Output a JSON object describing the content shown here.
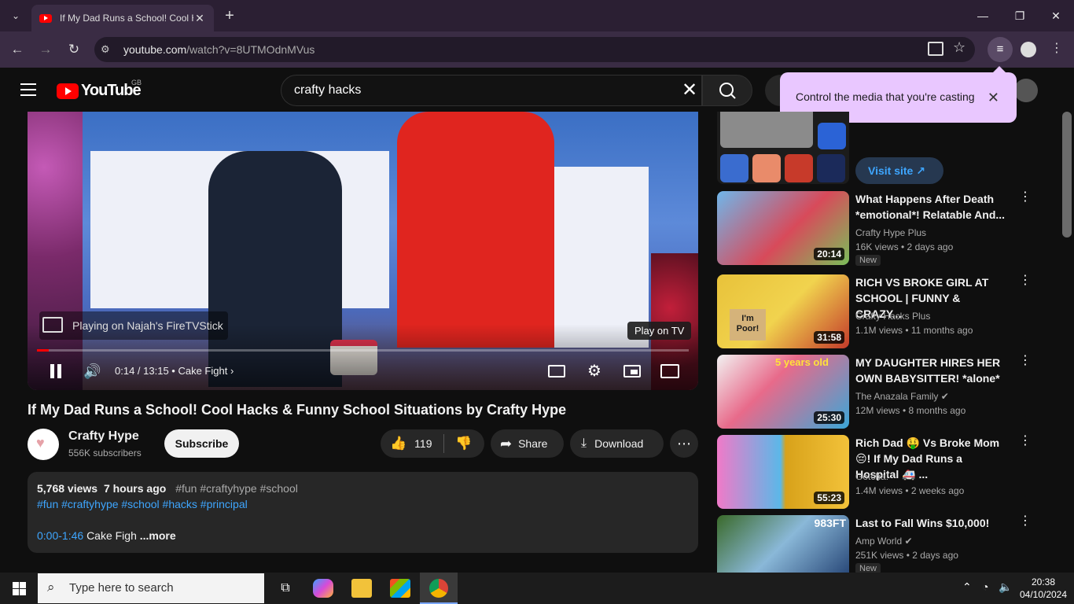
{
  "browser": {
    "tab_title": "If My Dad Runs a School! Cool Hacks & Funny School Situations by Crafty Hype",
    "url_host": "youtube.com",
    "url_path": "/watch?v=8UTMOdnMVus"
  },
  "youtube": {
    "logo_text": "YouTube",
    "country_code": "GB",
    "search_value": "crafty hacks"
  },
  "cast_popup": {
    "text": "Control the media that you're casting"
  },
  "player": {
    "cast_status": "Playing on Najah's FireTVStick",
    "tooltip": "Play on TV",
    "time": "0:14 / 13:15",
    "chapter": "Cake Fight",
    "progress_fraction": 0.018
  },
  "video": {
    "title": "If My Dad Runs a School! Cool Hacks & Funny School Situations by Crafty Hype",
    "channel": "Crafty Hype",
    "subscribers": "556K subscribers",
    "subscribe_label": "Subscribe",
    "likes": "119",
    "share_label": "Share",
    "download_label": "Download"
  },
  "description": {
    "views": "5,768 views",
    "age": "7 hours ago",
    "tags_inline": "#fun #craftyhype #school",
    "hashtags": "#fun #craftyhype #school #hacks #principal",
    "timestamp": "0:00-1:46",
    "chapter": "Cake Figh",
    "more": "...more"
  },
  "sidebar": {
    "visit_site": "Visit site",
    "items": [
      {
        "title": "What Happens After Death *emotional*! Relatable And...",
        "channel": "Crafty Hype Plus",
        "meta": "16K views • 2 days ago",
        "badge": "New",
        "duration": "20:14"
      },
      {
        "title": "RICH VS BROKE GIRL AT SCHOOL | FUNNY & CRAZY...",
        "channel": "Crafty Hacks Plus",
        "meta": "1.1M views • 11 months ago",
        "badge": "",
        "duration": "31:58"
      },
      {
        "title": "MY DAUGHTER HIRES HER OWN BABYSITTER! *alone*",
        "channel": "The Anazala Family",
        "meta": "12M views • 8 months ago",
        "badge": "",
        "duration": "25:30"
      },
      {
        "title": "Rich Dad 🤑 Vs Broke Mom 😔! If My Dad Runs a Hospital 🚑 ...",
        "channel": "Gotcha!",
        "meta": "1.4M views • 2 weeks ago",
        "badge": "",
        "duration": "55:23"
      },
      {
        "title": "Last to Fall Wins $10,000!",
        "channel": "Amp World",
        "meta": "251K views • 2 days ago",
        "badge": "New",
        "duration": ""
      }
    ]
  },
  "thumb_text": {
    "item2_sign": "I'm Poor!",
    "item3_banner": "5 years old",
    "item5_height": "983FT"
  },
  "taskbar": {
    "search_placeholder": "Type here to search",
    "time": "20:38",
    "date": "04/10/2024"
  }
}
